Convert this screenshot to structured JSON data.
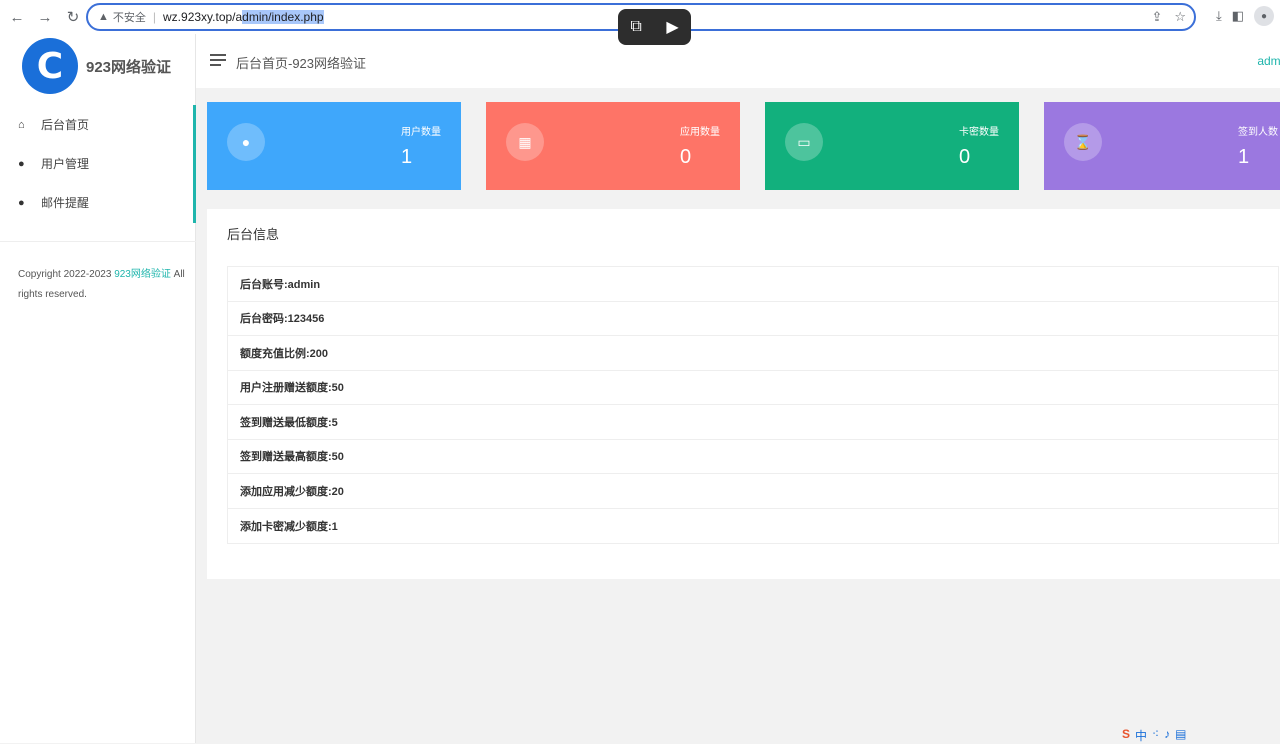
{
  "browser": {
    "insecure_label": "不安全",
    "url_plain": "wz.923xy.top/a",
    "url_selected": "dmin/index.php"
  },
  "brand": {
    "logo_letter": "C",
    "name": "923网络验证"
  },
  "header": {
    "title": "后台首页-923网络验证",
    "user": "admin"
  },
  "sidebar": {
    "items": [
      {
        "label": "后台首页",
        "icon": "home-icon"
      },
      {
        "label": "用户管理",
        "icon": "user-icon"
      },
      {
        "label": "邮件提醒",
        "icon": "user-icon"
      }
    ],
    "copyright_prefix": "Copyright 2022-2023 ",
    "copyright_link": "923网络验证",
    "copyright_suffix": " All rights reserved."
  },
  "stats": [
    {
      "label": "用户数量",
      "value": "1",
      "color": "#3fa7fb",
      "icon": "user-icon"
    },
    {
      "label": "应用数量",
      "value": "0",
      "color": "#fe7467",
      "icon": "grid-icon"
    },
    {
      "label": "卡密数量",
      "value": "0",
      "color": "#12b07d",
      "icon": "card-icon"
    },
    {
      "label": "签到人数",
      "value": "1",
      "color": "#9b78e0",
      "icon": "hourglass-icon"
    }
  ],
  "panel": {
    "title": "后台信息",
    "rows": [
      "后台账号:admin",
      "后台密码:123456",
      "额度充值比例:200",
      "用户注册赠送额度:50",
      "签到赠送最低额度:5",
      "签到赠送最高额度:50",
      "添加应用减少额度:20",
      "添加卡密减少额度:1"
    ]
  },
  "colors": {
    "accent": "#1fb5ac",
    "brand": "#1a6fd9"
  }
}
